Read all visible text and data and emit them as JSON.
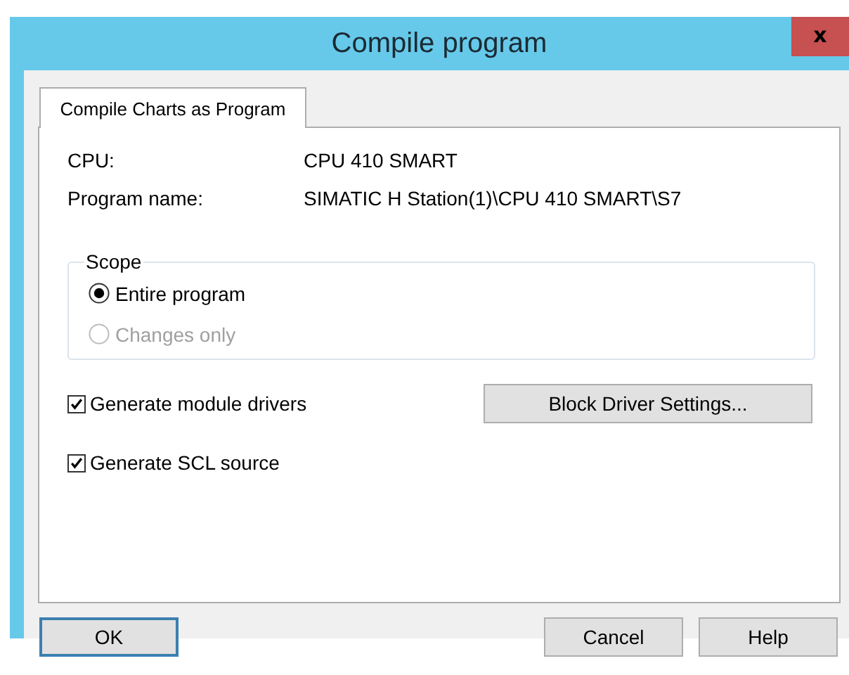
{
  "window": {
    "title": "Compile program",
    "close": "x"
  },
  "tabs": [
    {
      "label": "Compile Charts as Program",
      "selected": true
    }
  ],
  "fields": [
    {
      "label": "CPU:",
      "value": "CPU 410 SMART"
    },
    {
      "label": "Program name:",
      "value": "SIMATIC H Station(1)\\CPU 410 SMART\\S7"
    }
  ],
  "scope": {
    "title": "Scope",
    "options": [
      {
        "label": "Entire program",
        "selected": true,
        "disabled": false
      },
      {
        "label": "Changes only",
        "selected": false,
        "disabled": true
      }
    ]
  },
  "options": [
    {
      "label": "Generate module drivers",
      "checked": true
    },
    {
      "label": "Generate SCL source",
      "checked": true
    }
  ],
  "settings_button": "Block Driver Settings...",
  "buttons": [
    {
      "label": "OK",
      "default": true
    },
    {
      "label": "Cancel",
      "default": false
    },
    {
      "label": "Help",
      "default": false
    }
  ]
}
